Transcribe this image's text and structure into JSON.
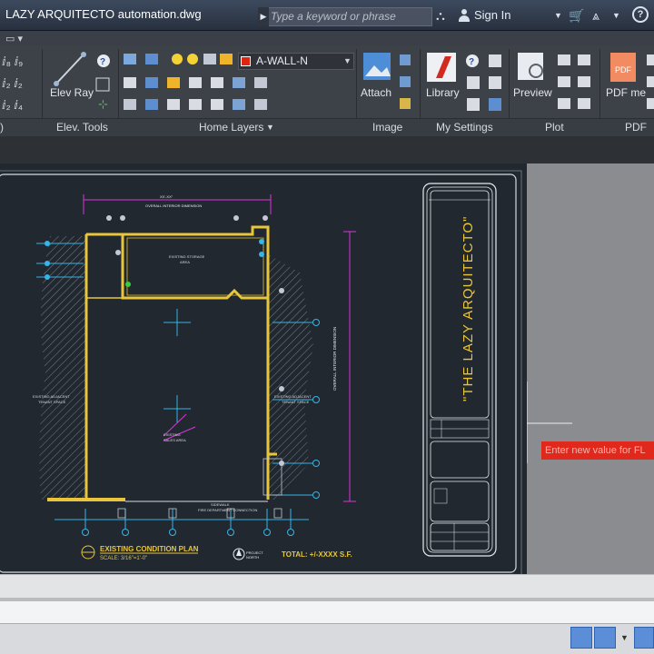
{
  "titlebar": {
    "title": "LAZY ARQUITECTO automation.dwg",
    "search_placeholder": "Type a keyword or phrase",
    "signin_label": "Sign In",
    "icons": [
      "binoculars-icon",
      "user-icon",
      "cart-icon",
      "autodesk-icon",
      "help-icon"
    ]
  },
  "ribbon": {
    "layer_current": "A-WALL-N",
    "layer_color": "#e0240f",
    "buttons": {
      "elev_ray": "Elev Ray",
      "attach": "Attach",
      "library": "Library",
      "preview": "Preview",
      "pdf_me": "PDF me"
    },
    "panels": [
      "Elev. Tools",
      "Home Layers",
      "Image",
      "My Settings",
      "Plot",
      "PDF"
    ]
  },
  "drawing": {
    "plan_title": "EXISTING CONDITION PLAN",
    "plan_scale": "SCALE: 3/16\"=1'-0\"",
    "total_label": "TOTAL: +/-XXXX S.F.",
    "titleblock_text": "\"THE LAZY ARQUITECTO\"",
    "dynamic_input": "Enter new value for FL"
  },
  "colors": {
    "wall_yellow": "#e8c53a",
    "dim_magenta": "#d636d6",
    "grid_cyan": "#35b5e8",
    "hatch": "#7f8690"
  }
}
